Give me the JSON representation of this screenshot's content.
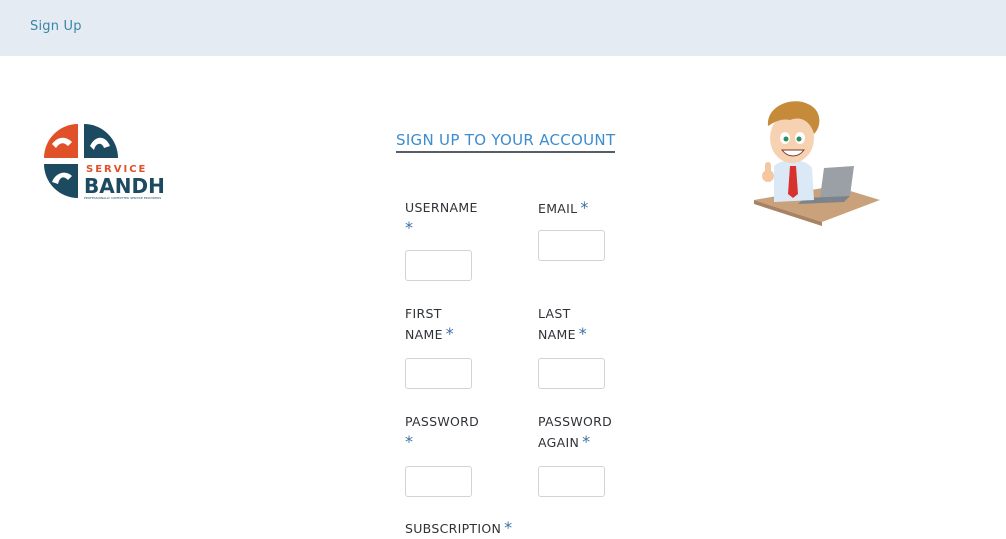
{
  "header": {
    "breadcrumb": "Sign Up"
  },
  "branding": {
    "logo_top_text": "SERVICE",
    "logo_main_text": "BANDHU",
    "logo_tagline": "PROFESSIONALLY COMMITTED SERVICE PROVIDERS"
  },
  "form": {
    "title": "SIGN UP TO YOUR ACCOUNT",
    "required_mark": "*",
    "fields": {
      "username": {
        "label": "USERNAME",
        "value": ""
      },
      "email": {
        "label": "EMAIL",
        "value": ""
      },
      "first_name": {
        "label_line1": "FIRST",
        "label_line2": "NAME",
        "value": ""
      },
      "last_name": {
        "label_line1": "LAST",
        "label_line2": "NAME",
        "value": ""
      },
      "password": {
        "label": "PASSWORD",
        "value": ""
      },
      "password_again": {
        "label_line1": "PASSWORD",
        "label_line2": "AGAIN",
        "value": ""
      },
      "subscription": {
        "label": "SUBSCRIPTION"
      }
    }
  },
  "colors": {
    "header_bg": "#e4ebf2",
    "link": "#3a86a8",
    "title": "#3c8ccf",
    "required": "#3c6ea6"
  }
}
